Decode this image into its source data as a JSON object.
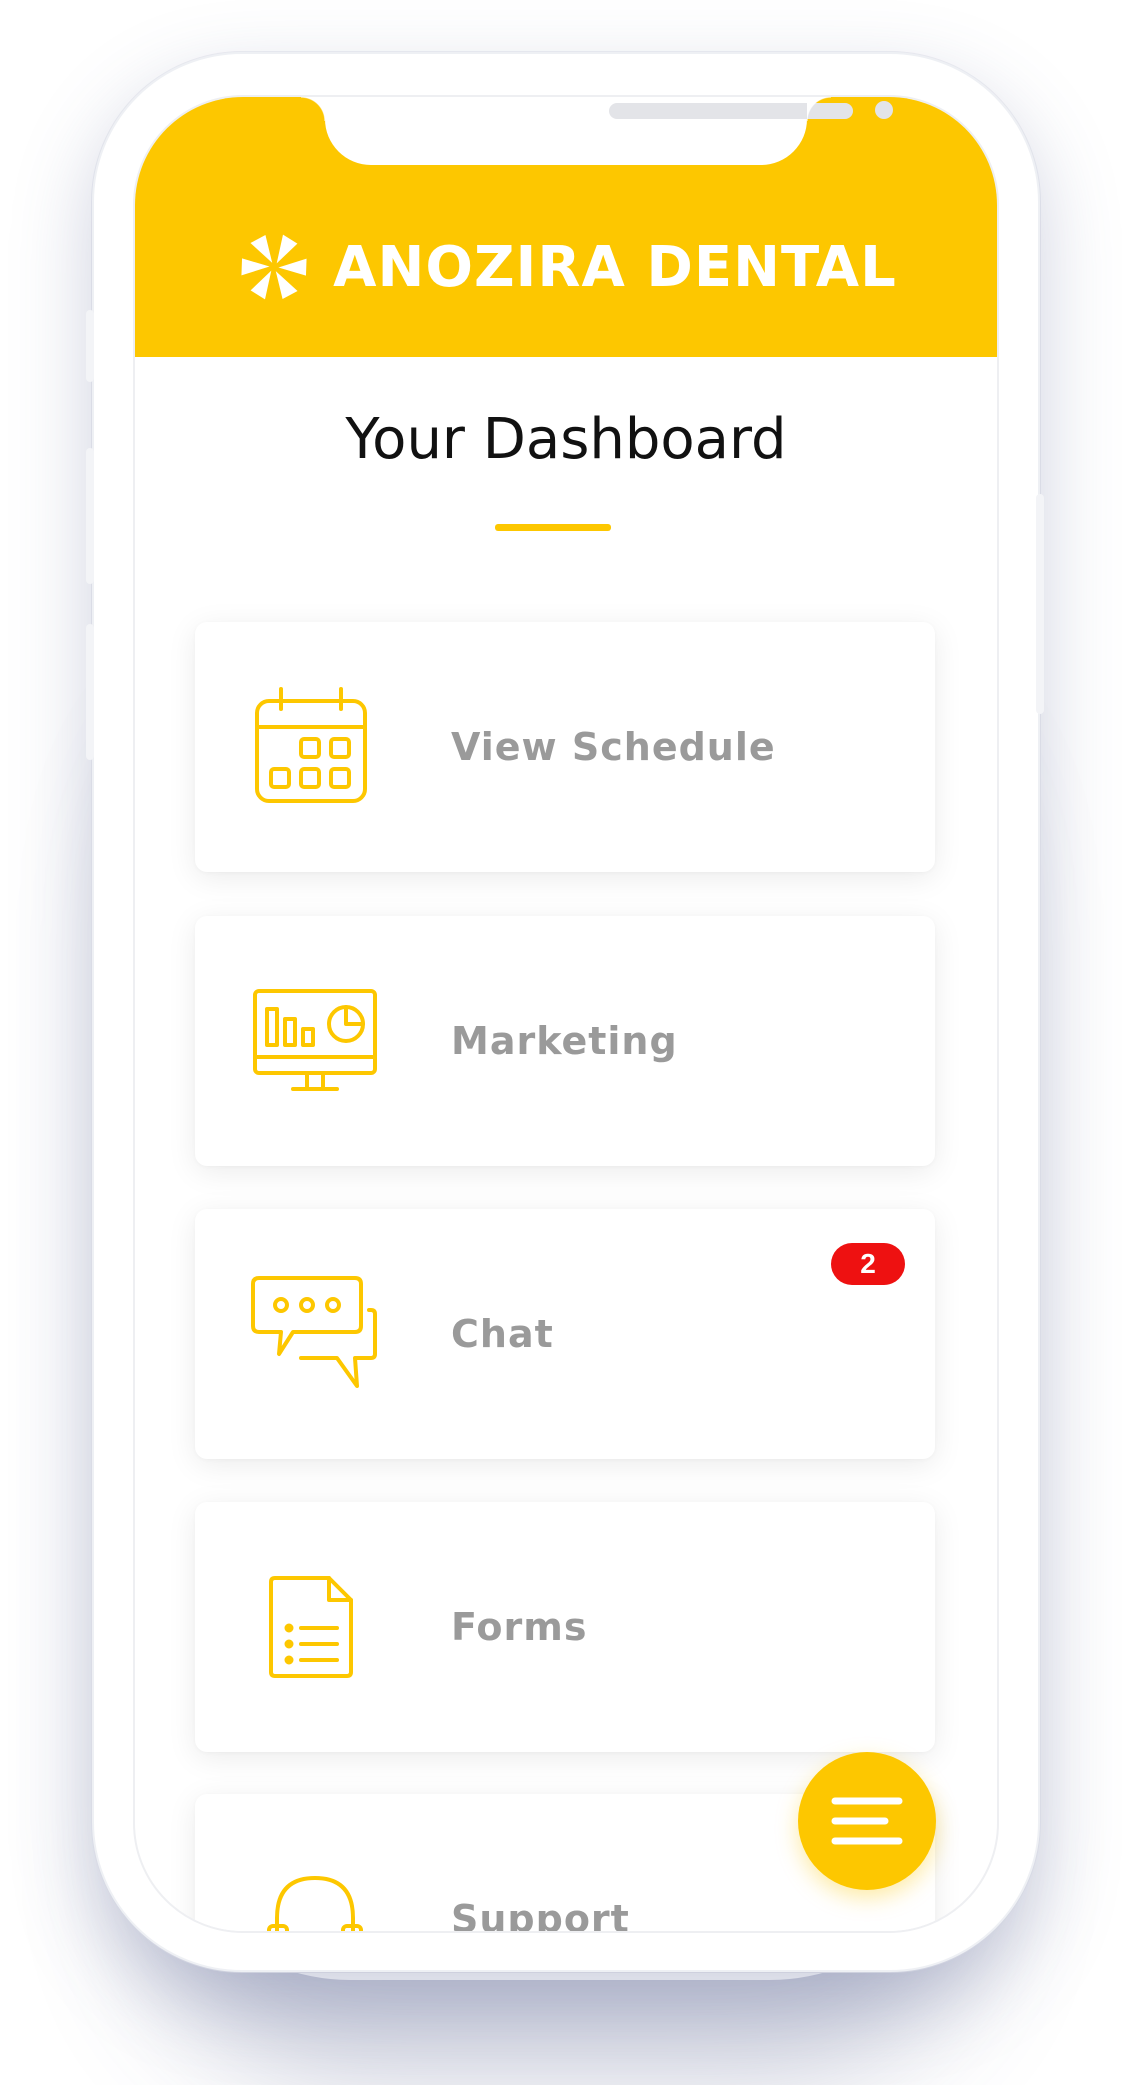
{
  "app": {
    "brand_name": "ANOZIRA DENTAL",
    "logo_icon": "pinwheel-logo-icon",
    "accent_color": "#fdc700"
  },
  "dashboard": {
    "title": "Your Dashboard"
  },
  "menu": {
    "items": [
      {
        "label": "View Schedule",
        "icon": "calendar-icon"
      },
      {
        "label": "Marketing",
        "icon": "monitor-chart-icon"
      },
      {
        "label": "Chat",
        "icon": "chat-bubbles-icon",
        "badge": "2"
      },
      {
        "label": "Forms",
        "icon": "document-list-icon"
      },
      {
        "label": "Support",
        "icon": "headset-icon"
      }
    ]
  },
  "fab": {
    "icon": "menu-lines-icon"
  }
}
